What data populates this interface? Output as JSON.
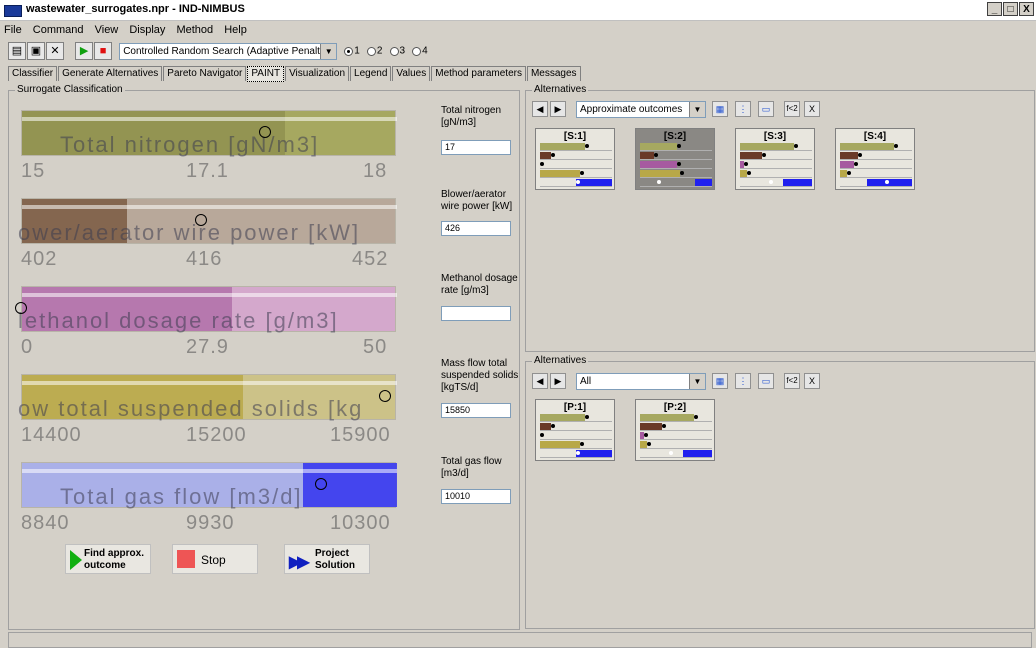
{
  "window": {
    "title": "wastewater_surrogates.npr - IND-NIMBUS",
    "minimize": "_",
    "maximize": "□",
    "close": "X"
  },
  "menu": [
    "File",
    "Command",
    "View",
    "Display",
    "Method",
    "Help"
  ],
  "toolbar": {
    "method": "Controlled Random Search (Adaptive Penalties)",
    "radio_labels": [
      "1",
      "2",
      "3",
      "4"
    ],
    "radio_selected": "1"
  },
  "tabs": [
    "Classifier",
    "Generate Alternatives",
    "Pareto Navigator",
    "PAINT",
    "Visualization",
    "Legend",
    "Values",
    "Method parameters",
    "Messages"
  ],
  "active_tab": "PAINT",
  "surrogate": {
    "title": "Surrogate Classification",
    "bars": [
      {
        "label": "Total nitrogen [gN/m3]",
        "ticks": [
          "15",
          "17.1",
          "18"
        ],
        "field_label": "Total nitrogen [gN/m3]",
        "value": "17",
        "color": "#a6a860",
        "fill_color": "#8f9050",
        "fill_fraction": 0.7,
        "marker_fraction": 0.65
      },
      {
        "label": "ower/aerator wire power [kW]",
        "ticks": [
          "402",
          "416",
          "452"
        ],
        "field_label": "Blower/aerator wire power [kW]",
        "value": "426",
        "color": "#b8a89a",
        "fill_color": "#7a5a42",
        "fill_fraction": 0.28,
        "marker_fraction": 0.48
      },
      {
        "label": "lethanol dosage rate [g/m3]",
        "ticks": [
          "0",
          "27.9",
          "50"
        ],
        "field_label": "Methanol dosage rate [g/m3]",
        "value": "",
        "color": "#d4a8cc",
        "fill_color": "#b070a8",
        "fill_fraction": 0.56,
        "marker_fraction": 0.0
      },
      {
        "label": "ow total suspended solids [kg",
        "ticks": [
          "14400",
          "15200",
          "15900"
        ],
        "field_label": "Mass flow total suspended solids [kgTS/d]",
        "value": "15850",
        "color": "#ccc288",
        "fill_color": "#b8a848",
        "fill_fraction": 0.59,
        "marker_fraction": 0.97
      },
      {
        "label": "Total gas flow [m3/d]",
        "ticks": [
          "8840",
          "9930",
          "10300"
        ],
        "field_label": "Total gas flow [m3/d]",
        "value": "10010",
        "color": "#aab0e8",
        "fill_color": "#3333ee",
        "fill_fraction_start": 0.75,
        "fill_fraction": 0.25,
        "marker_fraction": 0.8
      }
    ],
    "buttons": {
      "find": "Find approx. outcome",
      "stop": "Stop",
      "project": "Project Solution"
    }
  },
  "alternatives_top": {
    "title": "Alternatives",
    "filter": "Approximate outcomes",
    "cards": [
      {
        "label": "[S:1]",
        "selected": false
      },
      {
        "label": "[S:2]",
        "selected": true
      },
      {
        "label": "[S:3]",
        "selected": false
      },
      {
        "label": "[S:4]",
        "selected": false
      }
    ]
  },
  "alternatives_bottom": {
    "title": "Alternatives",
    "filter": "All",
    "cards": [
      {
        "label": "[P:1]",
        "selected": false
      },
      {
        "label": "[P:2]",
        "selected": false
      }
    ]
  },
  "icons": {
    "fx": "f<2",
    "close": "X"
  }
}
